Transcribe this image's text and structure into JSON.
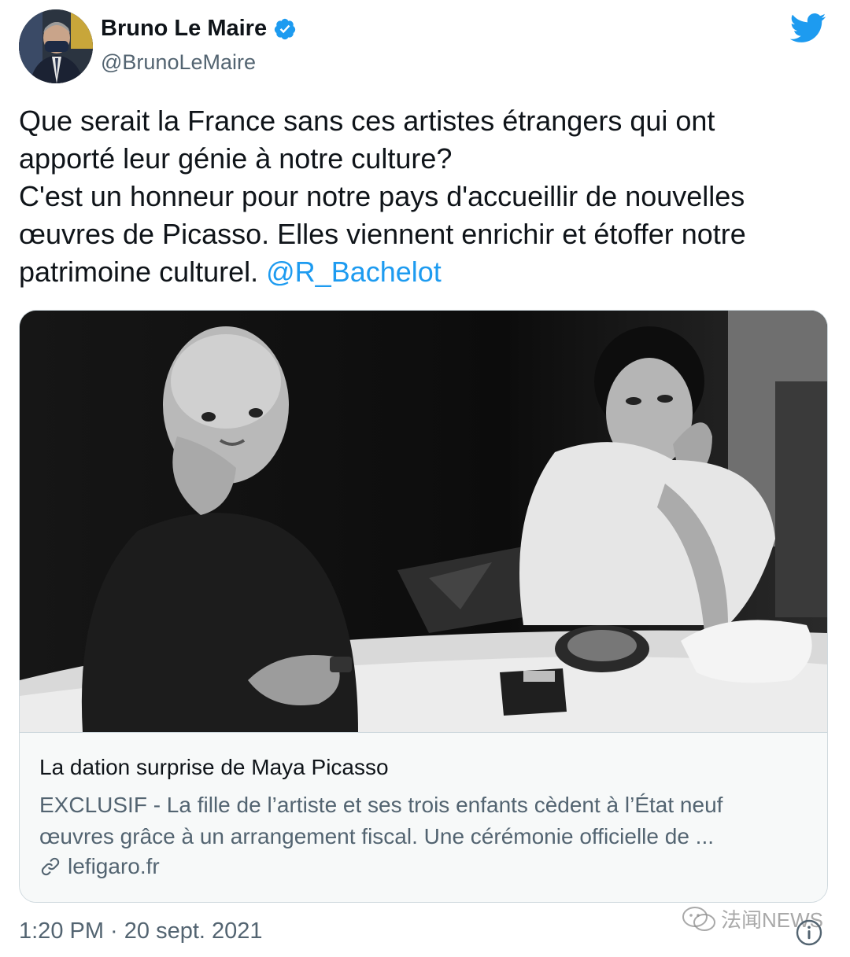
{
  "author": {
    "display_name": "Bruno Le Maire",
    "handle": "@BrunoLeMaire",
    "verified_icon": "verified-badge-icon",
    "avatar": "avatar"
  },
  "brand": {
    "logo_icon": "twitter-bird-icon",
    "accent_color": "#1d9bf0"
  },
  "tweet": {
    "lines": [
      "Que serait la France sans ces artistes étrangers qui ont",
      "apporté leur génie à notre culture?",
      "C'est un honneur pour notre pays d'accueillir de nouvelles",
      "œuvres de Picasso. Elles viennent enrichir et étoffer notre"
    ],
    "last_line_text": "patrimoine culturel. ",
    "mention": "@R_Bachelot"
  },
  "card": {
    "image_alt": "black-and-white photograph",
    "title": "La dation surprise de Maya Picasso",
    "description_lines": [
      "EXCLUSIF - La fille de l’artiste et ses trois enfants cèdent à l’État neuf",
      "œuvres grâce à un arrangement fiscal. Une cérémonie officielle de ..."
    ],
    "domain": "lefigaro.fr",
    "link_icon": "link-icon"
  },
  "footer": {
    "timestamp": "1:20 PM · 20 sept. 2021",
    "info_icon": "info-icon"
  },
  "watermark": {
    "text": "法闻NEWS",
    "icon": "wechat-icon"
  }
}
